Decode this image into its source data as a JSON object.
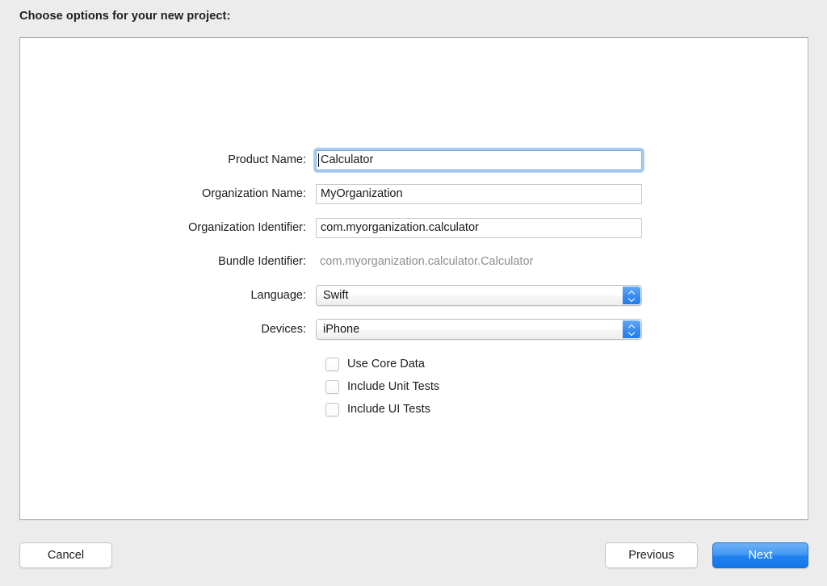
{
  "header": {
    "title": "Choose options for your new project:"
  },
  "form": {
    "rows": [
      {
        "label": "Product Name:",
        "type": "text",
        "value": "Calculator",
        "focused": true
      },
      {
        "label": "Organization Name:",
        "type": "text",
        "value": "MyOrganization",
        "focused": false
      },
      {
        "label": "Organization Identifier:",
        "type": "text",
        "value": "com.myorganization.calculator",
        "focused": false
      },
      {
        "label": "Bundle Identifier:",
        "type": "static",
        "value": "com.myorganization.calculator.Calculator"
      },
      {
        "label": "Language:",
        "type": "popup",
        "value": "Swift"
      },
      {
        "label": "Devices:",
        "type": "popup",
        "value": "iPhone"
      }
    ],
    "checkboxes": [
      {
        "label": "Use Core Data",
        "checked": false
      },
      {
        "label": "Include Unit Tests",
        "checked": false
      },
      {
        "label": "Include UI Tests",
        "checked": false
      }
    ]
  },
  "footer": {
    "cancel_label": "Cancel",
    "previous_label": "Previous",
    "next_label": "Next"
  },
  "colors": {
    "window_background": "#ececec",
    "panel_background": "#ffffff",
    "panel_border": "#b4b4b4",
    "accent_blue": "#1f82ef",
    "focus_ring": "#a8cdf0",
    "disabled_text": "#8e8e93",
    "text": "#1c1c1c"
  }
}
